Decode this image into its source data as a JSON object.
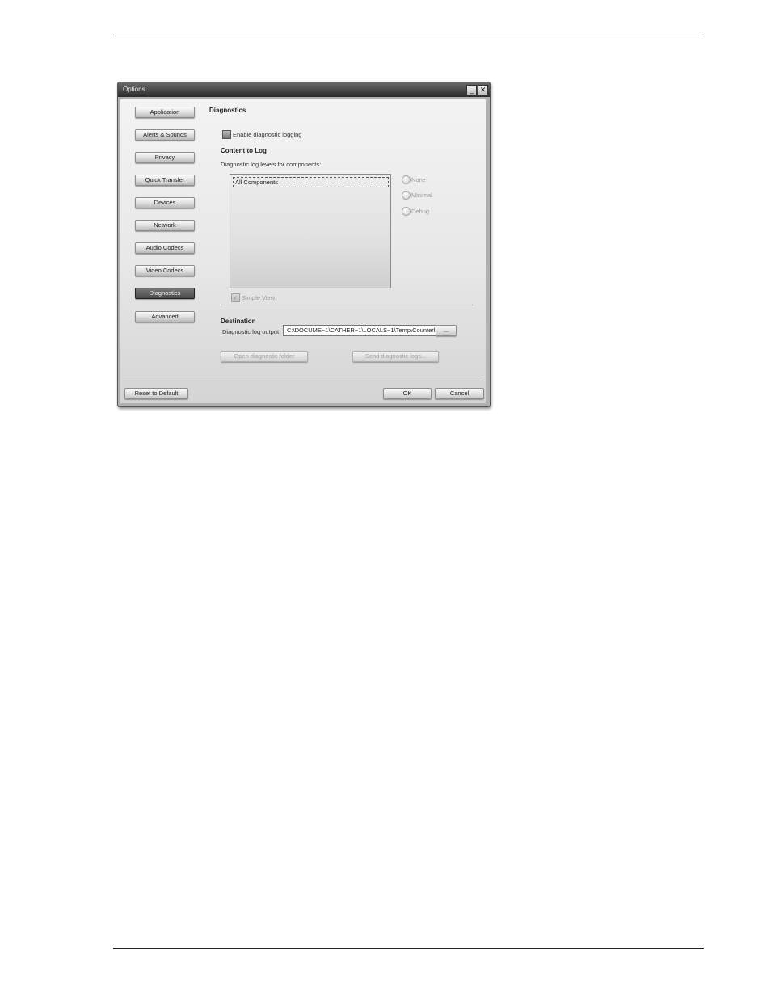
{
  "window": {
    "title": "Options",
    "minimize_glyph": "_",
    "close_glyph": "✕"
  },
  "nav": {
    "items": [
      {
        "label": "Application",
        "active": false
      },
      {
        "label": "Alerts & Sounds",
        "active": false
      },
      {
        "label": "Privacy",
        "active": false
      },
      {
        "label": "Quick Transfer",
        "active": false
      },
      {
        "label": "Devices",
        "active": false
      },
      {
        "label": "Network",
        "active": false
      },
      {
        "label": "Audio Codecs",
        "active": false
      },
      {
        "label": "Video Codecs",
        "active": false
      },
      {
        "label": "Diagnostics",
        "active": true
      },
      {
        "label": "Advanced",
        "active": false
      }
    ]
  },
  "diagnostics": {
    "title": "Diagnostics",
    "enable_logging_label": "Enable diagnostic logging",
    "content_section": "Content to Log",
    "levels_label": "Diagnostic log levels for components:;",
    "components": [
      "All Components"
    ],
    "levels": [
      "None",
      "Minimal",
      "Debug"
    ],
    "simple_view_label": "Simple View",
    "simple_view_check": "✓",
    "destination_section": "Destination",
    "log_output_label": "Diagnostic log output",
    "log_output_value": "C:\\DOCUME~1\\CATHER~1\\LOCALS~1\\Temp\\Counterl",
    "browse_label": "...",
    "open_folder_label": "Open diagnostic folder",
    "send_logs_label": "Send diagnostic logs..."
  },
  "footer": {
    "reset_label": "Reset to Default",
    "ok_label": "OK",
    "cancel_label": "Cancel"
  }
}
